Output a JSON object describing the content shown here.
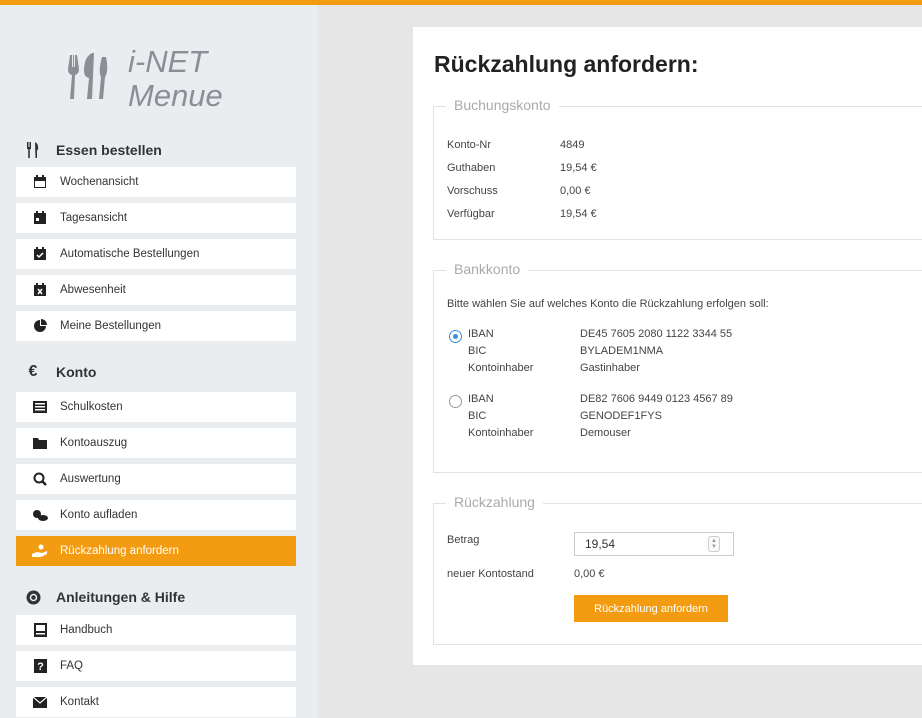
{
  "app": {
    "logo_line1": "i-NET",
    "logo_line2": "Menue"
  },
  "colors": {
    "accent": "#f39c12",
    "radio": "#3b8ed8"
  },
  "sidebar": {
    "sections": [
      {
        "title": "Essen bestellen",
        "icon": "cutlery-icon",
        "items": [
          {
            "label": "Wochenansicht",
            "icon": "calendar-icon"
          },
          {
            "label": "Tagesansicht",
            "icon": "calendar-day-icon"
          },
          {
            "label": "Automatische Bestellungen",
            "icon": "calendar-check-icon"
          },
          {
            "label": "Abwesenheit",
            "icon": "calendar-x-icon"
          },
          {
            "label": "Meine Bestellungen",
            "icon": "pie-chart-icon"
          }
        ]
      },
      {
        "title": "Konto",
        "icon": "euro-icon",
        "items": [
          {
            "label": "Schulkosten",
            "icon": "list-icon"
          },
          {
            "label": "Kontoauszug",
            "icon": "folder-icon"
          },
          {
            "label": "Auswertung",
            "icon": "magnifier-icon"
          },
          {
            "label": "Konto aufladen",
            "icon": "coins-icon"
          },
          {
            "label": "Rückzahlung anfordern",
            "icon": "hand-coin-icon",
            "active": true
          }
        ]
      },
      {
        "title": "Anleitungen & Hilfe",
        "icon": "help-circle-icon",
        "items": [
          {
            "label": "Handbuch",
            "icon": "book-icon"
          },
          {
            "label": "FAQ",
            "icon": "question-icon"
          },
          {
            "label": "Kontakt",
            "icon": "envelope-icon"
          }
        ]
      }
    ]
  },
  "main": {
    "title": "Rückzahlung anfordern:",
    "buchungskonto": {
      "legend": "Buchungskonto",
      "rows": [
        {
          "label": "Konto-Nr",
          "value": "4849"
        },
        {
          "label": "Guthaben",
          "value": "19,54 €"
        },
        {
          "label": "Vorschuss",
          "value": "0,00 €"
        },
        {
          "label": "Verfügbar",
          "value": "19,54 €"
        }
      ]
    },
    "bankkonto": {
      "legend": "Bankkonto",
      "instruction": "Bitte wählen Sie auf welches Konto die Rückzahlung erfolgen soll:",
      "accounts": [
        {
          "selected": true,
          "iban_label": "IBAN",
          "iban": "DE45 7605 2080 1122 3344 55",
          "bic_label": "BIC",
          "bic": "BYLADEM1NMA",
          "owner_label": "Kontoinhaber",
          "owner": "Gastinhaber"
        },
        {
          "selected": false,
          "iban_label": "IBAN",
          "iban": "DE82 7606 9449 0123 4567 89",
          "bic_label": "BIC",
          "bic": "GENODEF1FYS",
          "owner_label": "Kontoinhaber",
          "owner": "Demouser"
        }
      ]
    },
    "rueckzahlung": {
      "legend": "Rückzahlung",
      "betrag_label": "Betrag",
      "betrag_value": "19,54",
      "neuer_label": "neuer Kontostand",
      "neuer_value": "0,00 €",
      "button_label": "Rückzahlung anfordern"
    }
  }
}
